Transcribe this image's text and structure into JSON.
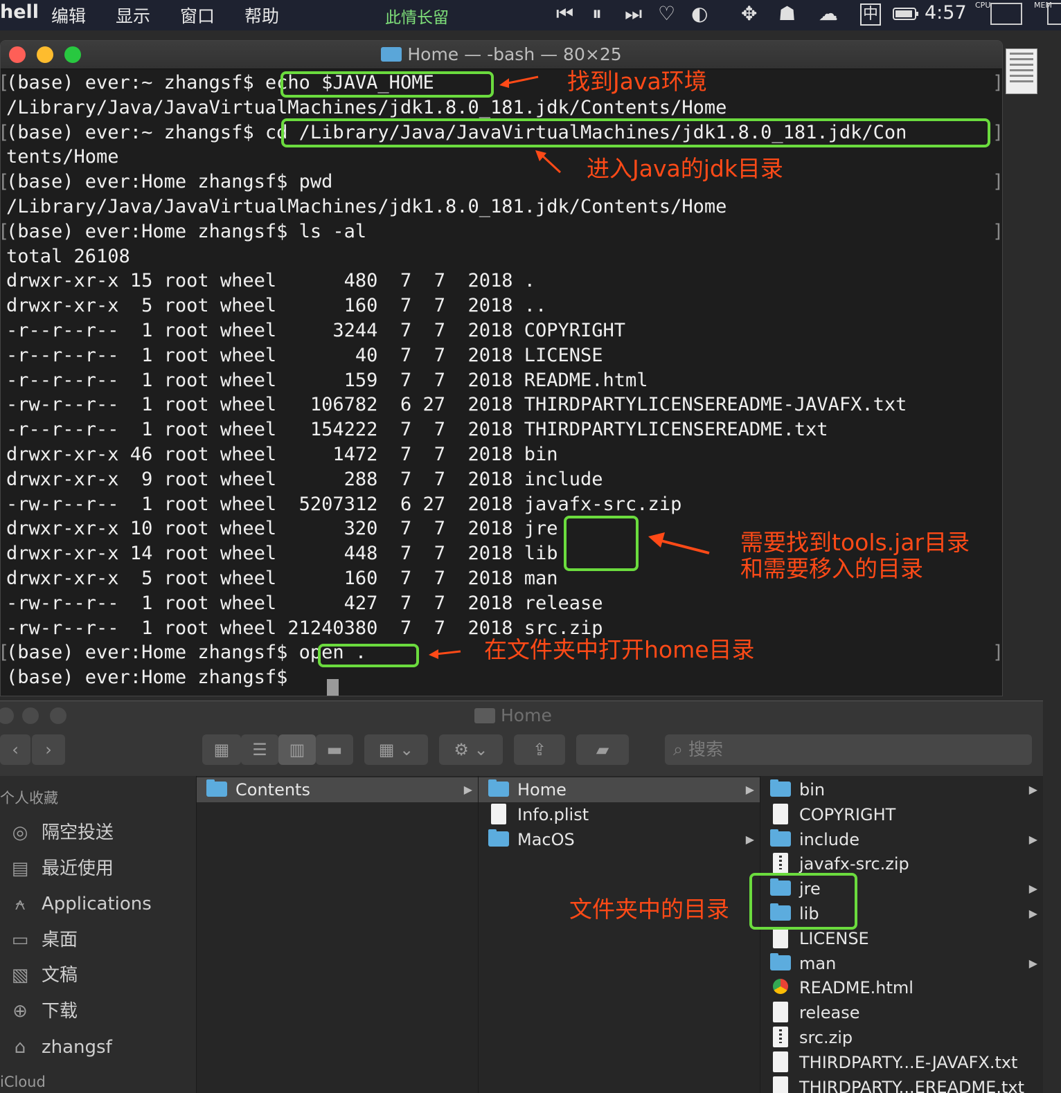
{
  "menubar": {
    "app_name": "hell",
    "menus": [
      "编辑",
      "显示",
      "窗口",
      "帮助"
    ],
    "now_playing": "此情长留",
    "clock": "4:57",
    "input_method": "中",
    "cpu_label": "CPU",
    "mem_label": "MEM",
    "icons": [
      "previous-track-icon",
      "pause-icon",
      "next-track-icon",
      "heart-icon",
      "music-service-icon",
      "dropbox-icon",
      "qq-icon",
      "wechat-icon",
      "input-method-icon",
      "battery-icon"
    ]
  },
  "terminal": {
    "title": "Home — -bash — 80×25",
    "lines": [
      "(base) ever:~ zhangsf$ echo $JAVA_HOME",
      "/Library/Java/JavaVirtualMachines/jdk1.8.0_181.jdk/Contents/Home",
      "(base) ever:~ zhangsf$ cd /Library/Java/JavaVirtualMachines/jdk1.8.0_181.jdk/Con",
      "tents/Home",
      "(base) ever:Home zhangsf$ pwd",
      "/Library/Java/JavaVirtualMachines/jdk1.8.0_181.jdk/Contents/Home",
      "(base) ever:Home zhangsf$ ls -al",
      "total 26108",
      "drwxr-xr-x 15 root wheel      480  7  7  2018 .",
      "drwxr-xr-x  5 root wheel      160  7  7  2018 ..",
      "-r--r--r--  1 root wheel     3244  7  7  2018 COPYRIGHT",
      "-r--r--r--  1 root wheel       40  7  7  2018 LICENSE",
      "-r--r--r--  1 root wheel      159  7  7  2018 README.html",
      "-rw-r--r--  1 root wheel   106782  6 27  2018 THIRDPARTYLICENSEREADME-JAVAFX.txt",
      "-r--r--r--  1 root wheel   154222  7  7  2018 THIRDPARTYLICENSEREADME.txt",
      "drwxr-xr-x 46 root wheel     1472  7  7  2018 bin",
      "drwxr-xr-x  9 root wheel      288  7  7  2018 include",
      "-rw-r--r--  1 root wheel  5207312  6 27  2018 javafx-src.zip",
      "drwxr-xr-x 10 root wheel      320  7  7  2018 jre",
      "drwxr-xr-x 14 root wheel      448  7  7  2018 lib",
      "drwxr-xr-x  5 root wheel      160  7  7  2018 man",
      "-rw-r--r--  1 root wheel      427  7  7  2018 release",
      "-rw-r--r--  1 root wheel 21240380  7  7  2018 src.zip",
      "(base) ever:Home zhangsf$ open .",
      "(base) ever:Home zhangsf$ "
    ],
    "annotations": {
      "java_env": "找到Java环境",
      "enter_jdk": "进入Java的jdk目录",
      "need_tools": "需要找到tools.jar目录\n和需要移入的目录",
      "open_home": "在文件夹中打开home目录",
      "folder_dirs": "文件夹中的目录"
    },
    "annotation_color": "#ff4a17",
    "highlight_color": "#6bdb3e"
  },
  "finder": {
    "title": "Home",
    "search_placeholder": "搜索",
    "sidebar_header": "个人收藏",
    "sidebar_items": [
      {
        "label": "隔空投送",
        "icon": "airdrop-icon"
      },
      {
        "label": "最近使用",
        "icon": "recents-icon"
      },
      {
        "label": "Applications",
        "icon": "applications-icon"
      },
      {
        "label": "桌面",
        "icon": "desktop-icon"
      },
      {
        "label": "文稿",
        "icon": "documents-icon"
      },
      {
        "label": "下载",
        "icon": "downloads-icon"
      },
      {
        "label": "zhangsf",
        "icon": "home-icon"
      }
    ],
    "sidebar_footer": "iCloud",
    "col1": [
      {
        "name": "Contents",
        "kind": "folder",
        "selected": true,
        "arrow": true
      }
    ],
    "col2": [
      {
        "name": "Home",
        "kind": "folder",
        "selected": true,
        "arrow": true
      },
      {
        "name": "Info.plist",
        "kind": "file",
        "arrow": false
      },
      {
        "name": "MacOS",
        "kind": "folder",
        "arrow": true
      }
    ],
    "col3": [
      {
        "name": "bin",
        "kind": "folder",
        "arrow": true
      },
      {
        "name": "COPYRIGHT",
        "kind": "file",
        "arrow": false
      },
      {
        "name": "include",
        "kind": "folder",
        "arrow": true
      },
      {
        "name": "javafx-src.zip",
        "kind": "zip",
        "arrow": false
      },
      {
        "name": "jre",
        "kind": "folder",
        "arrow": true
      },
      {
        "name": "lib",
        "kind": "folder",
        "arrow": true
      },
      {
        "name": "LICENSE",
        "kind": "file",
        "arrow": false
      },
      {
        "name": "man",
        "kind": "folder",
        "arrow": true
      },
      {
        "name": "README.html",
        "kind": "html",
        "arrow": false
      },
      {
        "name": "release",
        "kind": "file",
        "arrow": false
      },
      {
        "name": "src.zip",
        "kind": "zip",
        "arrow": false
      },
      {
        "name": "THIRDPARTY...E-JAVAFX.txt",
        "kind": "file",
        "arrow": false
      },
      {
        "name": "THIRDPARTY...EREADME.txt",
        "kind": "file",
        "arrow": false
      }
    ],
    "folder_color": "#5cacde"
  }
}
